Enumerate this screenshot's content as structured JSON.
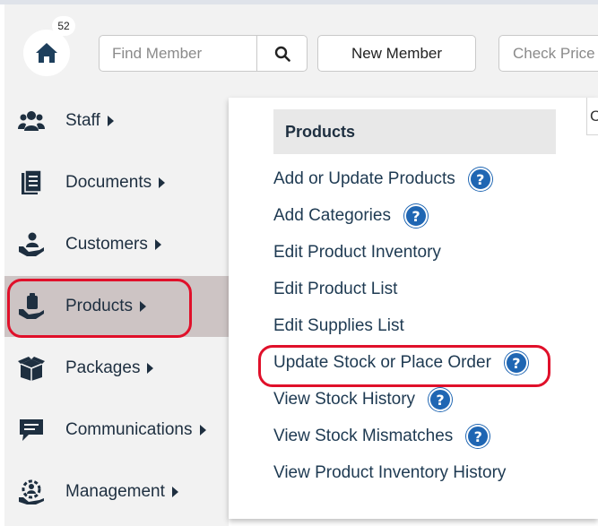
{
  "header": {
    "notification_count": "52",
    "search": {
      "placeholder": "Find Member"
    },
    "new_member_label": "New Member",
    "check_price_label": "Check Price"
  },
  "sidebar": {
    "items": [
      {
        "label": "Staff",
        "icon": "staff-icon"
      },
      {
        "label": "Documents",
        "icon": "documents-icon"
      },
      {
        "label": "Customers",
        "icon": "customers-icon"
      },
      {
        "label": "Products",
        "icon": "products-icon",
        "active": true,
        "highlighted": true
      },
      {
        "label": "Packages",
        "icon": "packages-icon"
      },
      {
        "label": "Communications",
        "icon": "communications-icon"
      },
      {
        "label": "Management",
        "icon": "management-icon"
      }
    ]
  },
  "submenu": {
    "title": "Products",
    "items": [
      {
        "label": "Add or Update Products",
        "help": true
      },
      {
        "label": "Add Categories",
        "help": true
      },
      {
        "label": "Edit Product Inventory",
        "help": false
      },
      {
        "label": "Edit Product List",
        "help": false
      },
      {
        "label": "Edit Supplies List",
        "help": false
      },
      {
        "label": "Update Stock or Place Order",
        "help": true,
        "highlighted": true
      },
      {
        "label": "View Stock History",
        "help": true
      },
      {
        "label": "View Stock Mismatches",
        "help": true
      },
      {
        "label": "View Product Inventory History",
        "help": false
      }
    ],
    "help_glyph": "?"
  },
  "colors": {
    "text_dark": "#1e2f40",
    "active_bg": "#cdc4c4",
    "help_blue": "#1f66b3",
    "highlight_red": "#e0102a"
  }
}
